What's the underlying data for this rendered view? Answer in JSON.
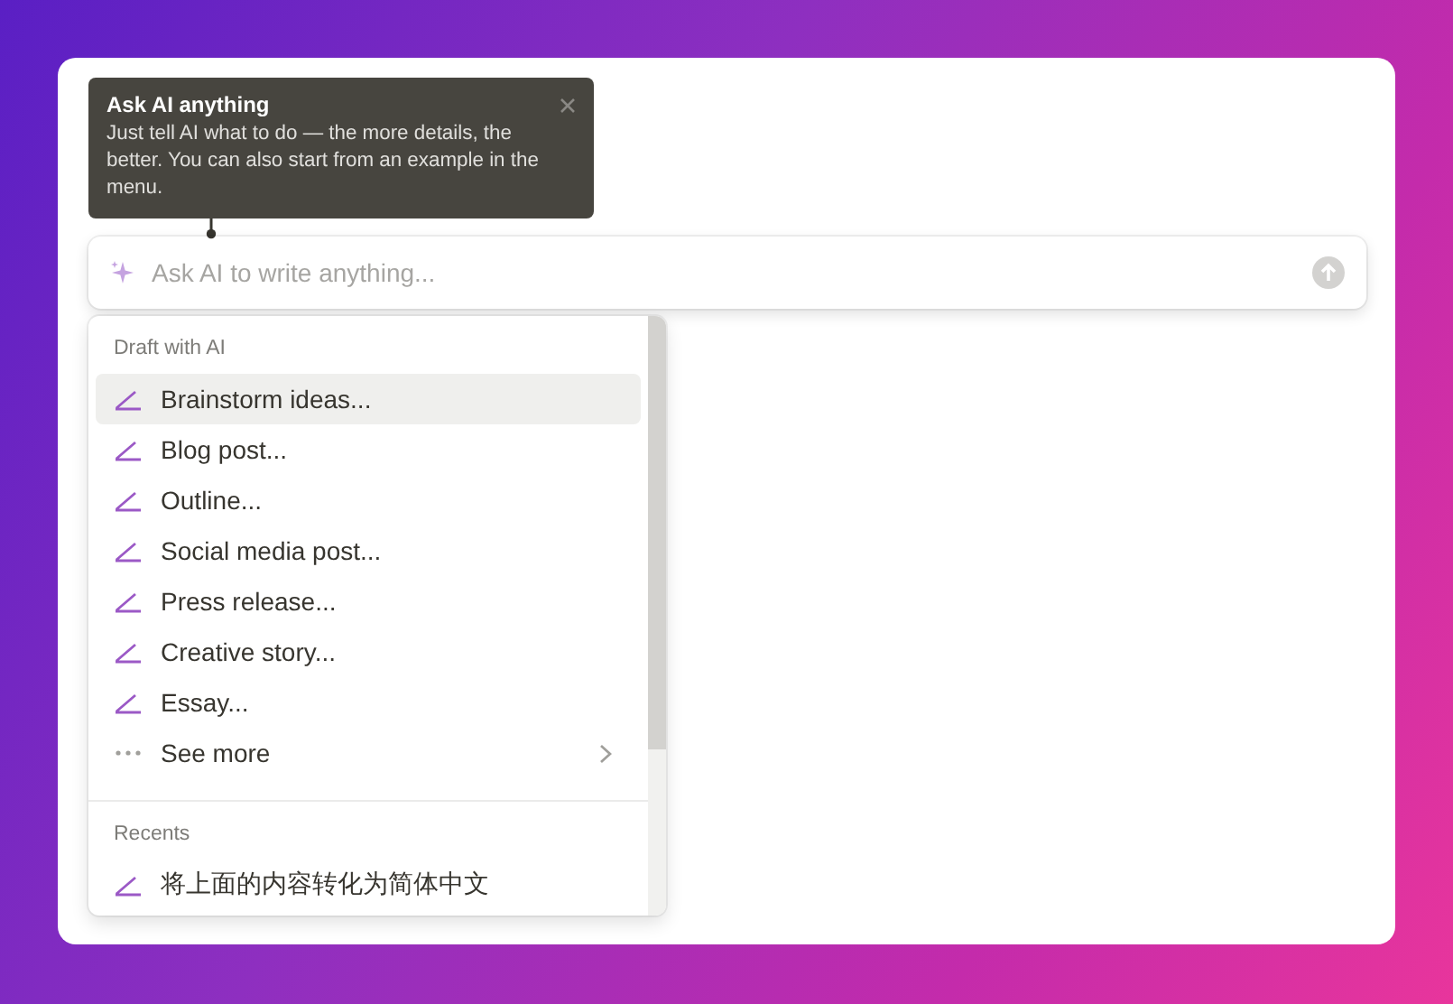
{
  "tooltip": {
    "title": "Ask AI anything",
    "text": "Just tell AI what to do — the more details, the better. You can also start from an example in the menu."
  },
  "prompt": {
    "placeholder": "Ask AI to write anything..."
  },
  "menu": {
    "sections": [
      {
        "heading": "Draft with AI",
        "items": [
          {
            "label": "Brainstorm ideas...",
            "kind": "pen",
            "selected": true
          },
          {
            "label": "Blog post...",
            "kind": "pen",
            "selected": false
          },
          {
            "label": "Outline...",
            "kind": "pen",
            "selected": false
          },
          {
            "label": "Social media post...",
            "kind": "pen",
            "selected": false
          },
          {
            "label": "Press release...",
            "kind": "pen",
            "selected": false
          },
          {
            "label": "Creative story...",
            "kind": "pen",
            "selected": false
          },
          {
            "label": "Essay...",
            "kind": "pen",
            "selected": false
          },
          {
            "label": "See more",
            "kind": "more",
            "selected": false
          }
        ]
      },
      {
        "heading": "Recents",
        "items": [
          {
            "label": "将上面的内容转化为简体中文",
            "kind": "pen",
            "selected": false
          }
        ]
      }
    ]
  }
}
